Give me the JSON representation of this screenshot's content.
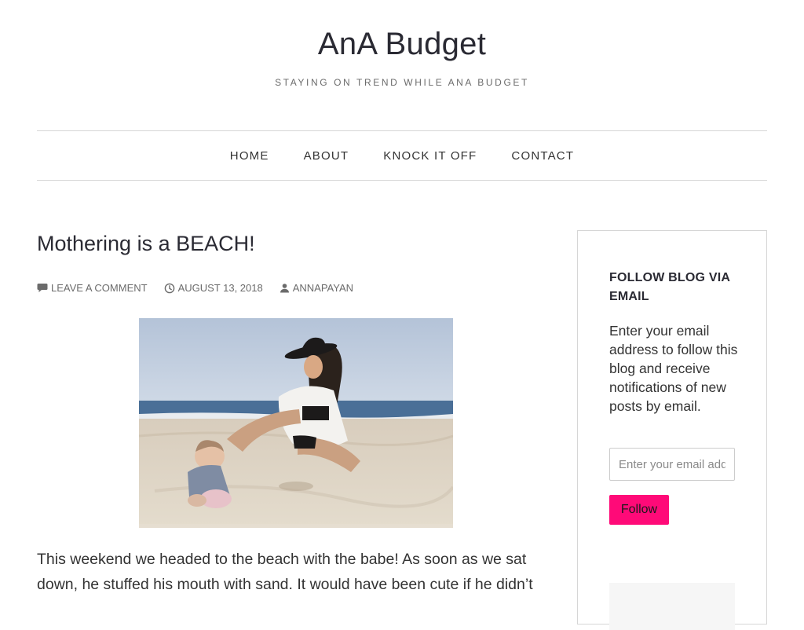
{
  "site": {
    "title": "AnA Budget",
    "tagline": "STAYING ON TREND WHILE ANA BUDGET"
  },
  "nav": {
    "items": [
      {
        "label": "HOME"
      },
      {
        "label": "ABOUT"
      },
      {
        "label": "KNOCK IT OFF"
      },
      {
        "label": "CONTACT"
      }
    ]
  },
  "post": {
    "title": "Mothering is a BEACH!",
    "meta": {
      "comments": "LEAVE A COMMENT",
      "date": "AUGUST 13, 2018",
      "author": "ANNAPAYAN",
      "comments_icon": "comment-bubble-icon",
      "date_icon": "clock-icon",
      "author_icon": "person-icon"
    },
    "body": "This weekend we headed to the beach with the babe! As soon as we sat down, he stuffed his mouth with sand. It would have been cute if he didn’t"
  },
  "sidebar": {
    "widget_title": "FOLLOW BLOG VIA EMAIL",
    "description": "Enter your email address to follow this blog and receive notifications of new posts by email.",
    "email_placeholder": "Enter your email address",
    "email_value": "",
    "follow_label": "Follow"
  },
  "colors": {
    "accent": "#ff0a78",
    "border": "#d6d6d6",
    "text": "#333333",
    "heading": "#2a2a33",
    "meta": "#6b6b6b"
  }
}
